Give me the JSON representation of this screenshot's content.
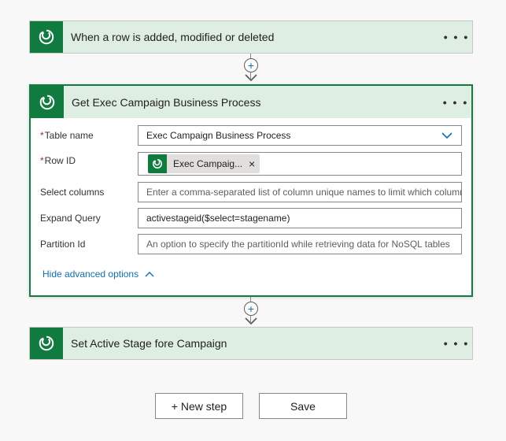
{
  "trigger": {
    "title": "When a row is added, modified or deleted",
    "more": "• • •",
    "icon": "dataverse-icon"
  },
  "action1": {
    "title": "Get Exec Campaign Business Process",
    "more": "• • •",
    "icon": "dataverse-icon",
    "fields": {
      "table_name": {
        "required_mark": "*",
        "label": "Table name",
        "value": "Exec Campaign Business Process"
      },
      "row_id": {
        "required_mark": "*",
        "label": "Row ID",
        "token_label": "Exec Campaig...",
        "token_remove": "×"
      },
      "select_columns": {
        "label": "Select columns",
        "placeholder": "Enter a comma-separated list of column unique names to limit which columns a"
      },
      "expand_query": {
        "label": "Expand Query",
        "value": "activestageid($select=stagename)"
      },
      "partition_id": {
        "label": "Partition Id",
        "placeholder": "An option to specify the partitionId while retrieving data for NoSQL tables"
      }
    },
    "advanced_link": "Hide advanced options"
  },
  "action2": {
    "title": "Set Active Stage fore Campaign",
    "more": "• • •",
    "icon": "dataverse-icon"
  },
  "insert_step": "+",
  "buttons": {
    "new_step": "+ New step",
    "save": "Save"
  },
  "colors": {
    "header_bg": "#dfeee3",
    "icon_bg": "#0f7b3f",
    "accent_border": "#107c41",
    "link": "#0f6cbd",
    "required": "#a4262c"
  }
}
